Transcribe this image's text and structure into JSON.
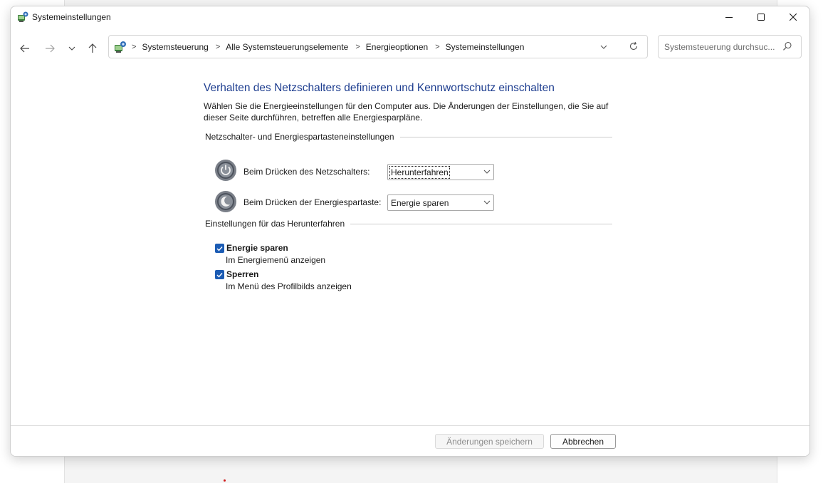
{
  "window": {
    "title": "Systemeinstellungen",
    "controls": {
      "minimize": "minimize",
      "maximize": "maximize",
      "close": "close"
    }
  },
  "address_bar": {
    "crumbs": [
      "Systemsteuerung",
      "Alle Systemsteuerungselemente",
      "Energieoptionen",
      "Systemeinstellungen"
    ]
  },
  "search": {
    "placeholder": "Systemsteuerung durchsuc..."
  },
  "page": {
    "title": "Verhalten des Netzschalters definieren und Kennwortschutz einschalten",
    "description": "Wählen Sie die Energieeinstellungen für den Computer aus. Die Änderungen der Einstellungen, die Sie auf dieser Seite durchführen, betreffen alle Energiesparpläne."
  },
  "power_settings": {
    "header": "Netzschalter- und Energiespartasteneinstellungen",
    "power_button": {
      "label": "Beim Drücken des Netzschalters:",
      "value": "Herunterfahren"
    },
    "sleep_button": {
      "label": "Beim Drücken der Energiespartaste:",
      "value": "Energie sparen"
    }
  },
  "shutdown_settings": {
    "header": "Einstellungen für das Herunterfahren",
    "options": [
      {
        "label": "Energie sparen",
        "sub": "Im Energiemenü anzeigen",
        "checked": true
      },
      {
        "label": "Sperren",
        "sub": "Im Menü des Profilbilds anzeigen",
        "checked": true
      }
    ]
  },
  "footer": {
    "save": "Änderungen speichern",
    "cancel": "Abbrechen"
  },
  "colors": {
    "title_blue": "#1d3d8f",
    "checkbox_blue": "#1c5cb4"
  }
}
